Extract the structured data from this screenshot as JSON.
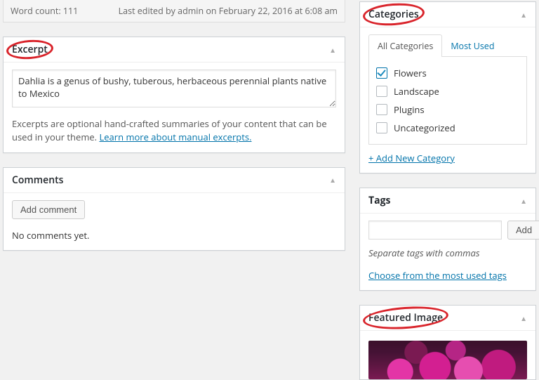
{
  "statusbar": {
    "word_count_label": "Word count: 111",
    "last_edited": "Last edited by admin on February 22, 2016 at 6:08 am"
  },
  "excerpt": {
    "title": "Excerpt",
    "value": "Dahlia is a genus of bushy, tuberous, herbaceous perennial plants native to Mexico",
    "hint_prefix": "Excerpts are optional hand-crafted summaries of your content that can be used in your theme. ",
    "hint_link": "Learn more about manual excerpts."
  },
  "comments": {
    "title": "Comments",
    "add_btn": "Add comment",
    "empty": "No comments yet."
  },
  "categories": {
    "title": "Categories",
    "tab_all": "All Categories",
    "tab_most": "Most Used",
    "items": [
      {
        "label": "Flowers",
        "checked": true
      },
      {
        "label": "Landscape",
        "checked": false
      },
      {
        "label": "Plugins",
        "checked": false
      },
      {
        "label": "Uncategorized",
        "checked": false
      }
    ],
    "add_new": "+ Add New Category"
  },
  "tags": {
    "title": "Tags",
    "add_btn": "Add",
    "input_value": "",
    "hint": "Separate tags with commas",
    "choose_link": "Choose from the most used tags"
  },
  "featured": {
    "title": "Featured Image"
  },
  "glyphs": {
    "toggle": "▲"
  }
}
